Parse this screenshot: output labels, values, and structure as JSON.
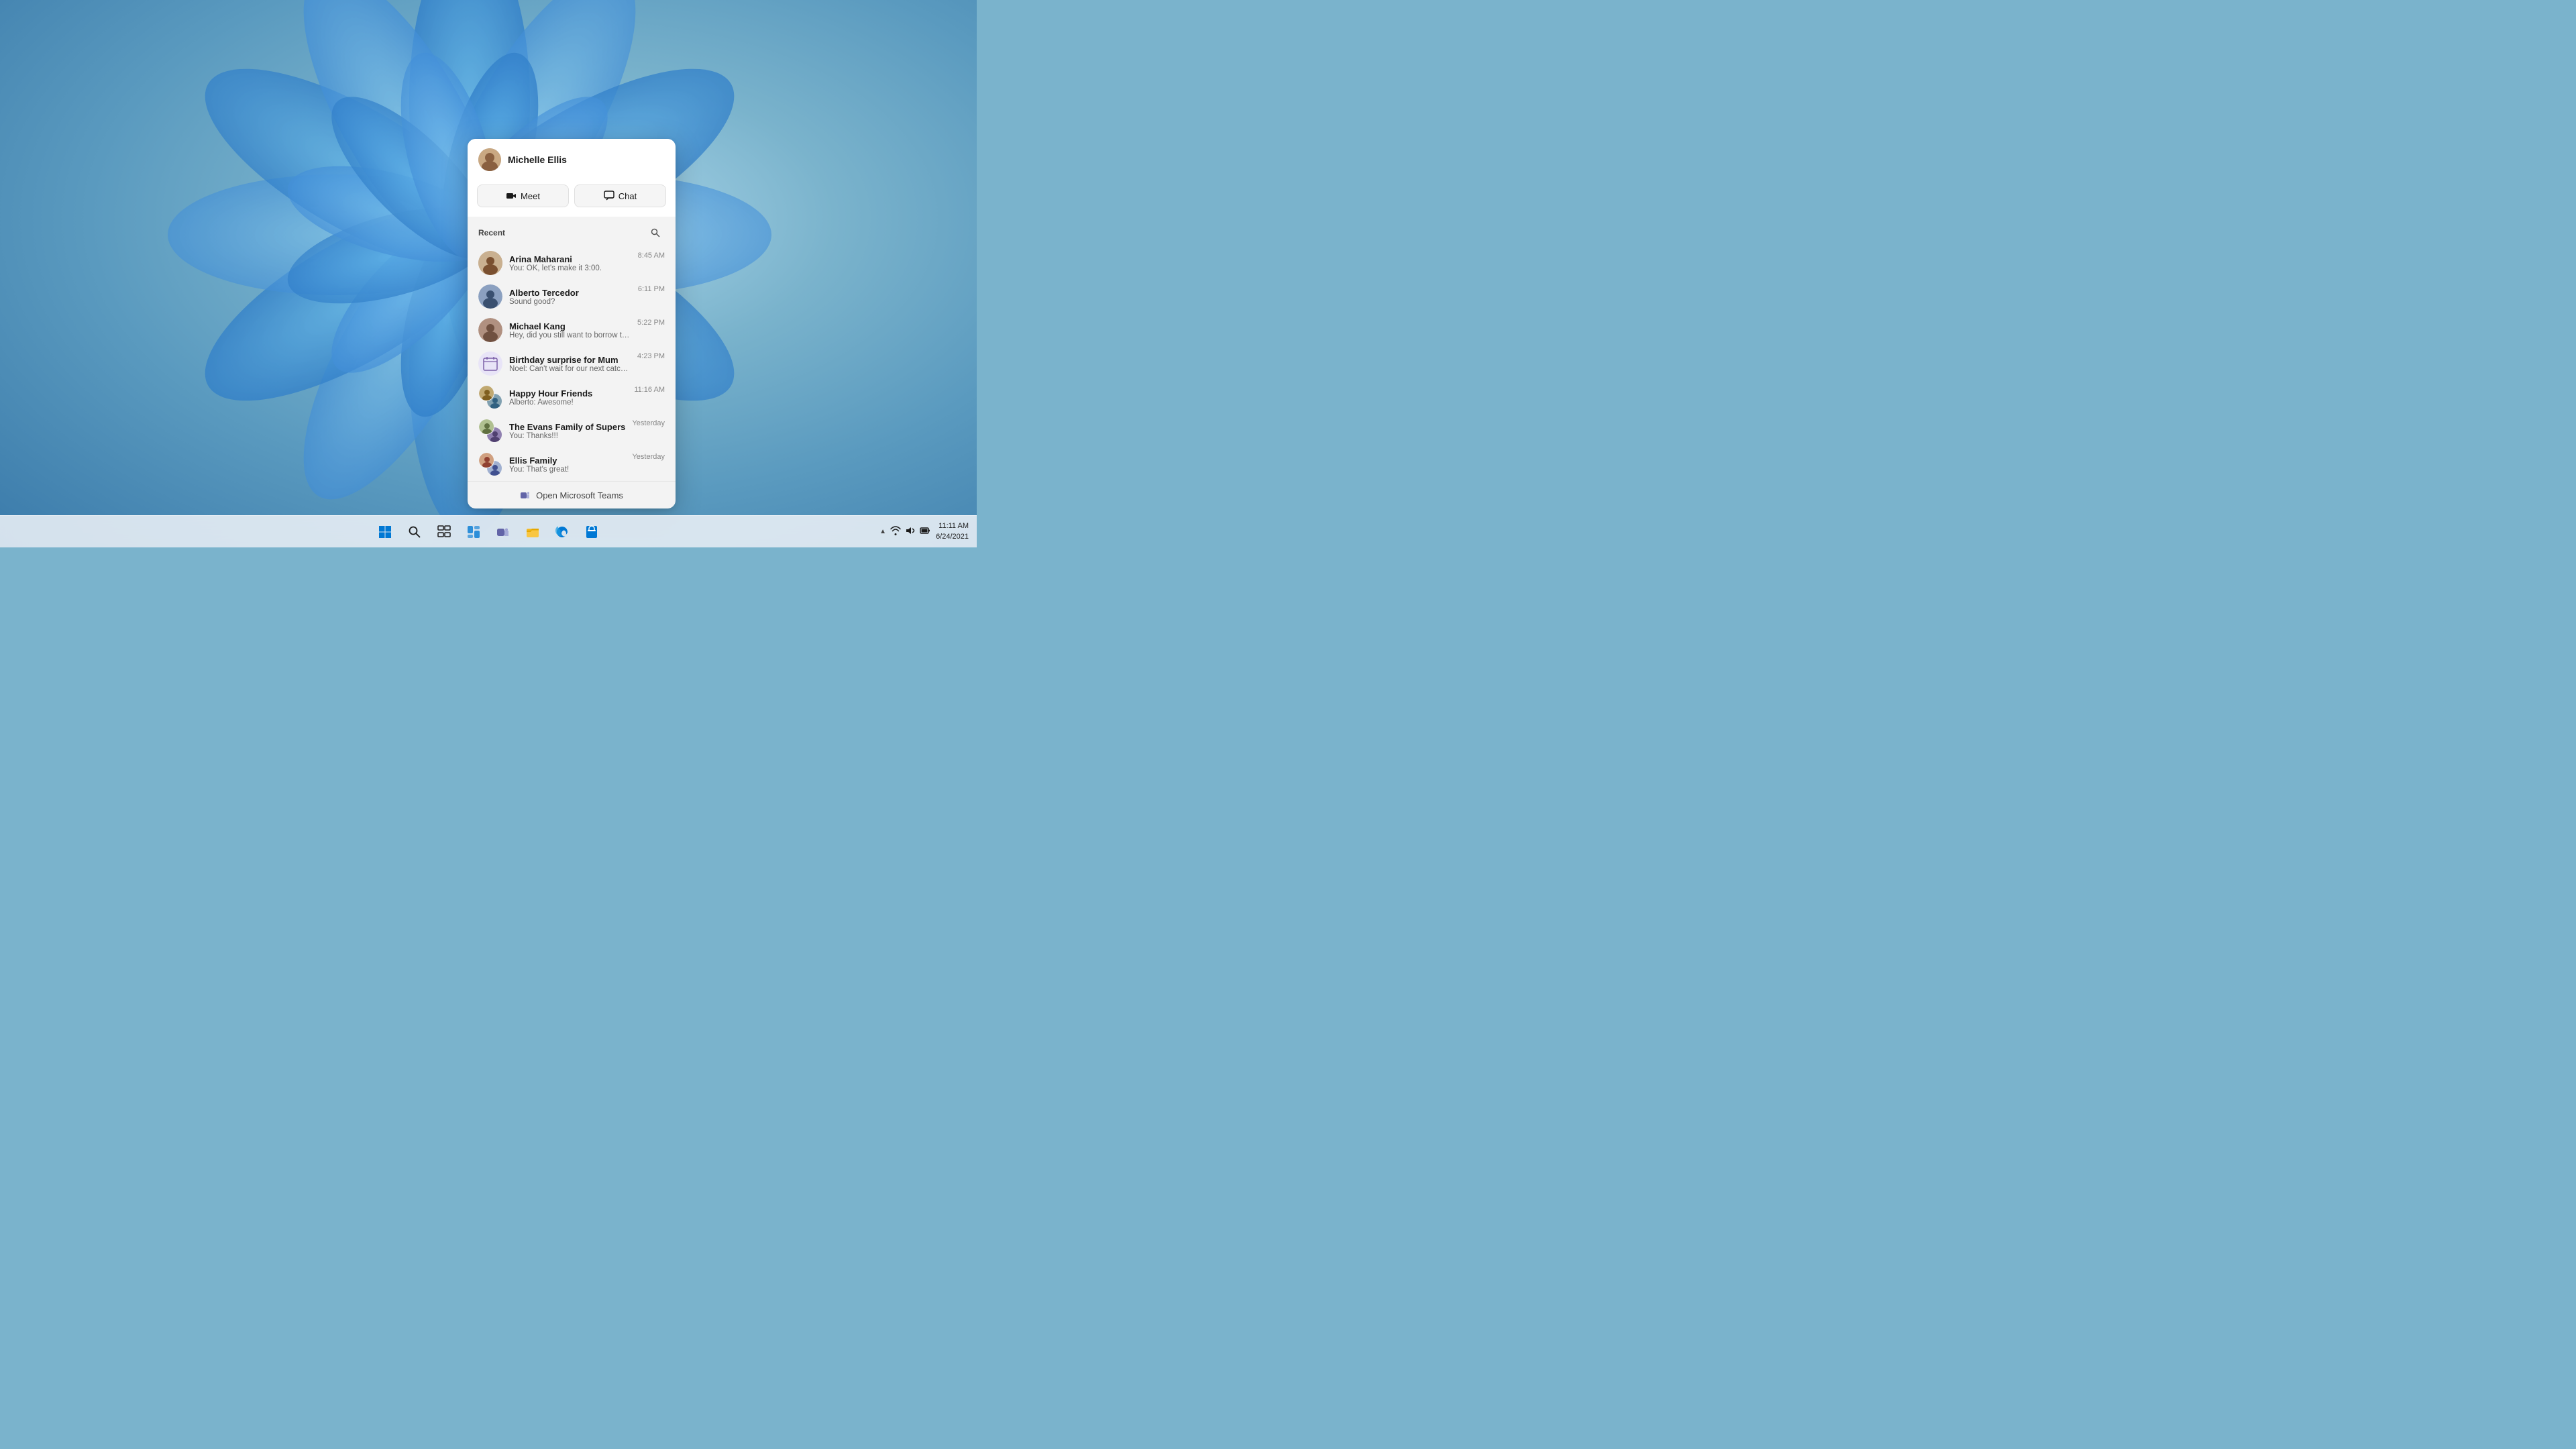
{
  "desktop": {
    "background_color": "#7ab3cc"
  },
  "teams_panel": {
    "user_name": "Michelle Ellis",
    "meet_label": "Meet",
    "chat_label": "Chat",
    "recent_label": "Recent",
    "open_teams_label": "Open Microsoft Teams",
    "chats": [
      {
        "id": "arina",
        "name": "Arina Maharani",
        "preview": "You: OK, let's make it 3:00.",
        "time": "8:45 AM",
        "type": "person",
        "color": "#c9b090"
      },
      {
        "id": "alberto",
        "name": "Alberto Tercedor",
        "preview": "Sound good?",
        "time": "6:11 PM",
        "type": "person",
        "color": "#8ba0c0"
      },
      {
        "id": "michael",
        "name": "Michael Kang",
        "preview": "Hey, did you still want to borrow the notes?",
        "time": "5:22 PM",
        "type": "person",
        "color": "#b09080"
      },
      {
        "id": "birthday",
        "name": "Birthday surprise for Mum",
        "preview": "Noel: Can't wait for our next catch up!",
        "time": "4:23 PM",
        "type": "calendar"
      },
      {
        "id": "happy-hour",
        "name": "Happy Hour Friends",
        "preview": "Alberto: Awesome!",
        "time": "11:16 AM",
        "type": "group",
        "color1": "#c0a870",
        "color2": "#80a0b0"
      },
      {
        "id": "evans-family",
        "name": "The Evans Family of Supers",
        "preview": "You: Thanks!!!",
        "time": "Yesterday",
        "type": "group",
        "color1": "#b0c090",
        "color2": "#9080b0"
      },
      {
        "id": "ellis-family",
        "name": "Ellis Family",
        "preview": "You: That's great!",
        "time": "Yesterday",
        "type": "group",
        "color1": "#d0a080",
        "color2": "#a0b0d0"
      }
    ]
  },
  "taskbar": {
    "time": "11:11 AM",
    "date": "6/24/2021",
    "icons": [
      {
        "name": "start-button",
        "symbol": "⊞",
        "label": "Start"
      },
      {
        "name": "search-button",
        "symbol": "🔍",
        "label": "Search"
      },
      {
        "name": "taskview-button",
        "symbol": "❑",
        "label": "Task View"
      },
      {
        "name": "widgets-button",
        "symbol": "▦",
        "label": "Widgets"
      },
      {
        "name": "teams-button",
        "symbol": "👥",
        "label": "Teams"
      },
      {
        "name": "explorer-button",
        "symbol": "📁",
        "label": "File Explorer"
      },
      {
        "name": "edge-button",
        "symbol": "🌐",
        "label": "Microsoft Edge"
      },
      {
        "name": "store-button",
        "symbol": "🛍",
        "label": "Microsoft Store"
      }
    ],
    "sys_icons": [
      "▲",
      "📶",
      "🔊",
      "🔋"
    ]
  }
}
